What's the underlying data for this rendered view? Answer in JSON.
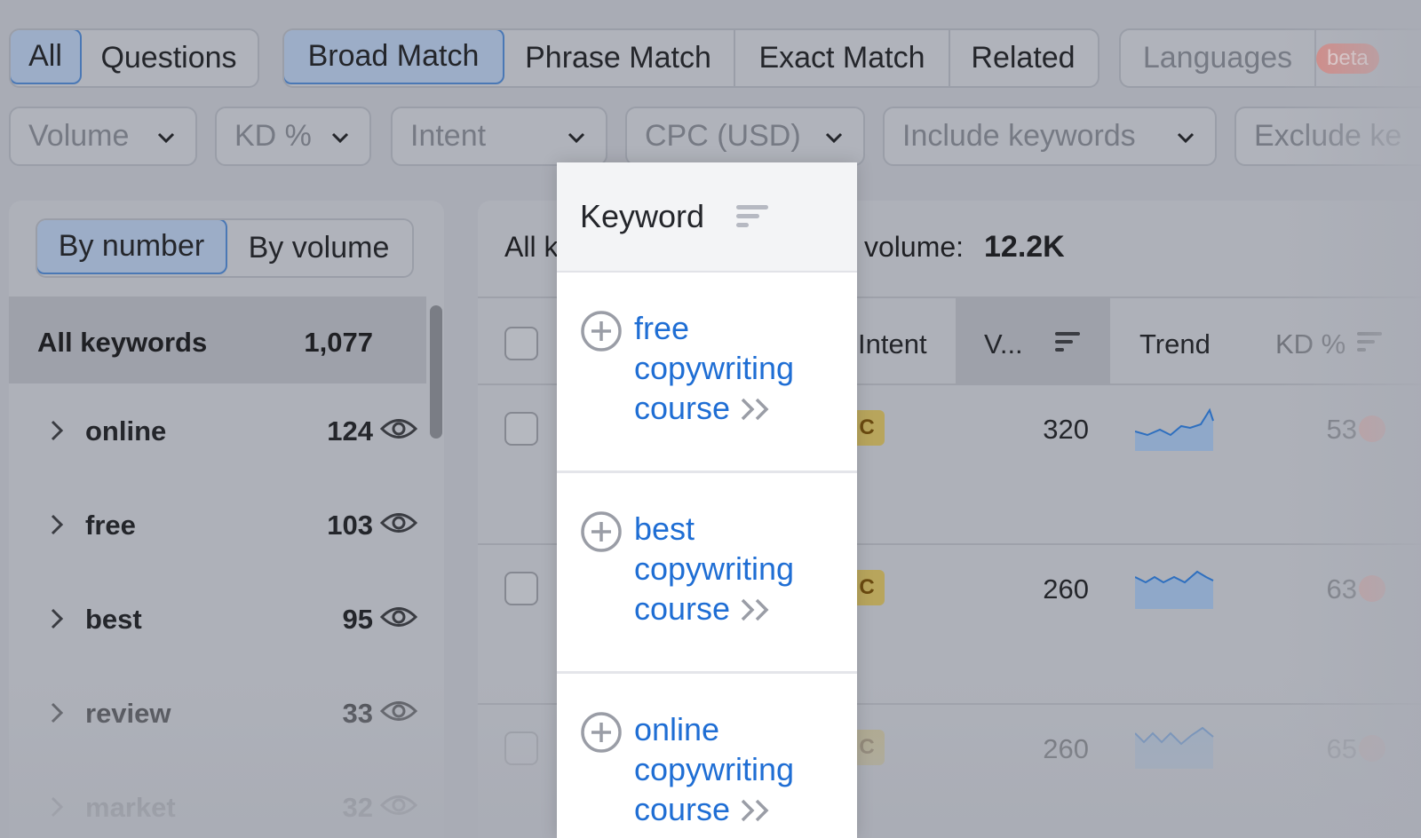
{
  "tabs_left": [
    {
      "label": "All",
      "active": true
    },
    {
      "label": "Questions",
      "active": false
    }
  ],
  "tabs_match": [
    {
      "label": "Broad Match",
      "active": true
    },
    {
      "label": "Phrase Match",
      "active": false
    },
    {
      "label": "Exact Match",
      "active": false
    },
    {
      "label": "Related",
      "active": false
    }
  ],
  "languages": {
    "label": "Languages",
    "badge": "beta"
  },
  "filters": [
    "Volume",
    "KD %",
    "Intent",
    "CPC (USD)",
    "Include keywords",
    "Exclude ke"
  ],
  "left_panel": {
    "segment": [
      {
        "label": "By number",
        "active": true
      },
      {
        "label": "By volume",
        "active": false
      }
    ],
    "all_keywords": {
      "label": "All keywords",
      "count": "1,077"
    },
    "groups": [
      {
        "label": "online",
        "count": "124"
      },
      {
        "label": "free",
        "count": "103"
      },
      {
        "label": "best",
        "count": "95"
      },
      {
        "label": "review",
        "count": "33"
      },
      {
        "label": "market",
        "count": "32"
      }
    ]
  },
  "main": {
    "summary_prefix": "All k",
    "summary_label": "volume:",
    "summary_value": "12.2K",
    "columns": {
      "intent": "Intent",
      "volume": "V...",
      "trend": "Trend",
      "kd": "KD %"
    },
    "rows": [
      {
        "intent": "C",
        "volume": "320",
        "kd": "53"
      },
      {
        "intent": "C",
        "volume": "260",
        "kd": "63"
      },
      {
        "intent": "C",
        "volume": "260",
        "kd": "65"
      }
    ]
  },
  "keyword_card": {
    "header": "Keyword",
    "items": [
      {
        "line1": "free",
        "line2": "copywriting",
        "line3": "course"
      },
      {
        "line1": "best",
        "line2": "copywriting",
        "line3": "course"
      },
      {
        "line1": "online",
        "line2": "copywriting",
        "line3": "course"
      }
    ]
  },
  "colors": {
    "link": "#1f6ed4",
    "active_tab": "#4a78b5",
    "badge": "#e8706a",
    "intent_commercial": "#b8a55c"
  },
  "icons": [
    "chevron-down-icon",
    "chevron-right-icon",
    "eye-icon",
    "sort-icon",
    "plus-circle-icon",
    "double-chevron-right-icon"
  ]
}
